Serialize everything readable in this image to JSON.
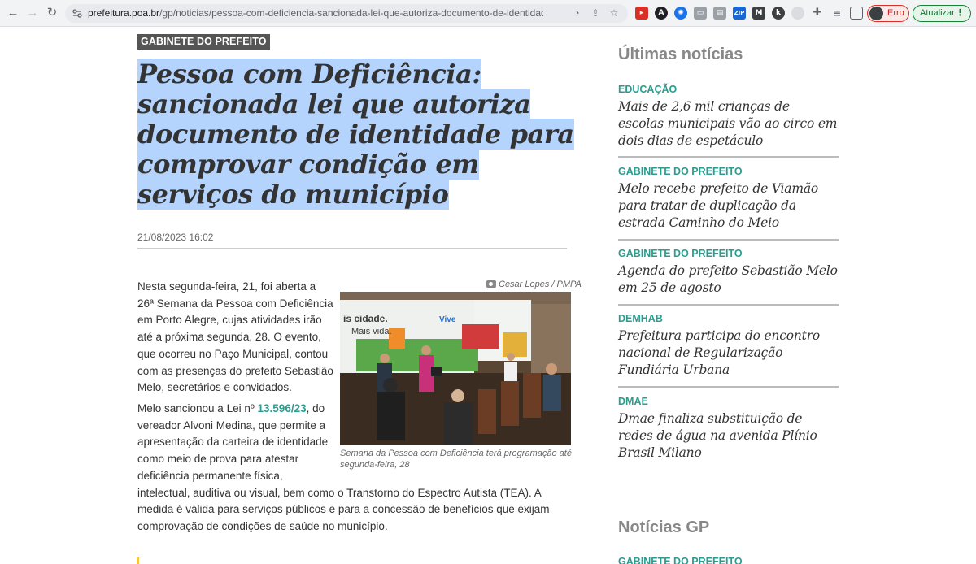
{
  "browser": {
    "url_host": "prefeitura.poa.br",
    "url_path": "/gp/noticias/pessoa-com-deficiencia-sancionada-lei-que-autoriza-documento-de-identidade-para",
    "profile_label": "Erro",
    "update_label": "Atualizar"
  },
  "article": {
    "category": "GABINETE DO PREFEITO",
    "headline": "Pessoa com Deficiência: sancionada lei que autoriza documento de identidade para comprovar condição em serviços do município",
    "date": "21/08/2023 16:02",
    "p1": [
      "Nesta segunda-feira, 21, foi aberta a",
      "26ª Semana da Pessoa com Deficiência",
      "em Porto Alegre, cujas atividades irão",
      "até a próxima segunda, 28. O evento,",
      "que ocorreu no Paço Municipal, contou",
      "com as presenças do prefeito Sebastião",
      "Melo, secretários e convidados."
    ],
    "p2_first_pre": "Melo sancionou a Lei nº ",
    "p2_link": "13.596/23",
    "p2_first_post": ", do",
    "p2": [
      "vereador Alvoni Medina, que permite a",
      "apresentação da carteira de identidade",
      "como meio de prova para atestar",
      "deficiência permanente física,",
      "intelectual, auditiva ou visual, bem como o Transtorno do Espectro Autista (TEA). A",
      "medida é válida para serviços públicos e para a concessão de benefícios que exijam",
      "comprovação de condições de saúde no município."
    ],
    "photo_credit": "Cesar Lopes / PMPA",
    "photo_caption": "Semana da Pessoa com Deficiência terá programação até segunda-feira, 28",
    "banner_line1": "is cidade.",
    "banner_line2": "Mais vida.",
    "banner_brand": "Vive"
  },
  "sidebar": {
    "latest_heading": "Últimas notícias",
    "items": [
      {
        "category": "EDUCAÇÃO",
        "title": "Mais de 2,6 mil crianças de escolas municipais vão ao circo em dois dias de espetáculo"
      },
      {
        "category": "GABINETE DO PREFEITO",
        "title": "Melo recebe prefeito de Viamão para tratar de duplicação da estrada Caminho do Meio"
      },
      {
        "category": "GABINETE DO PREFEITO",
        "title": "Agenda do prefeito Sebastião Melo em 25 de agosto"
      },
      {
        "category": "DEMHAB",
        "title": "Prefeitura participa do encontro nacional de Regularização Fundiária Urbana"
      },
      {
        "category": "DMAE",
        "title": "Dmae finaliza substituição de redes de água na avenida Plínio Brasil Milano"
      }
    ],
    "gp_heading": "Notícias GP",
    "gp_first_category": "GABINETE DO PREFEITO"
  }
}
